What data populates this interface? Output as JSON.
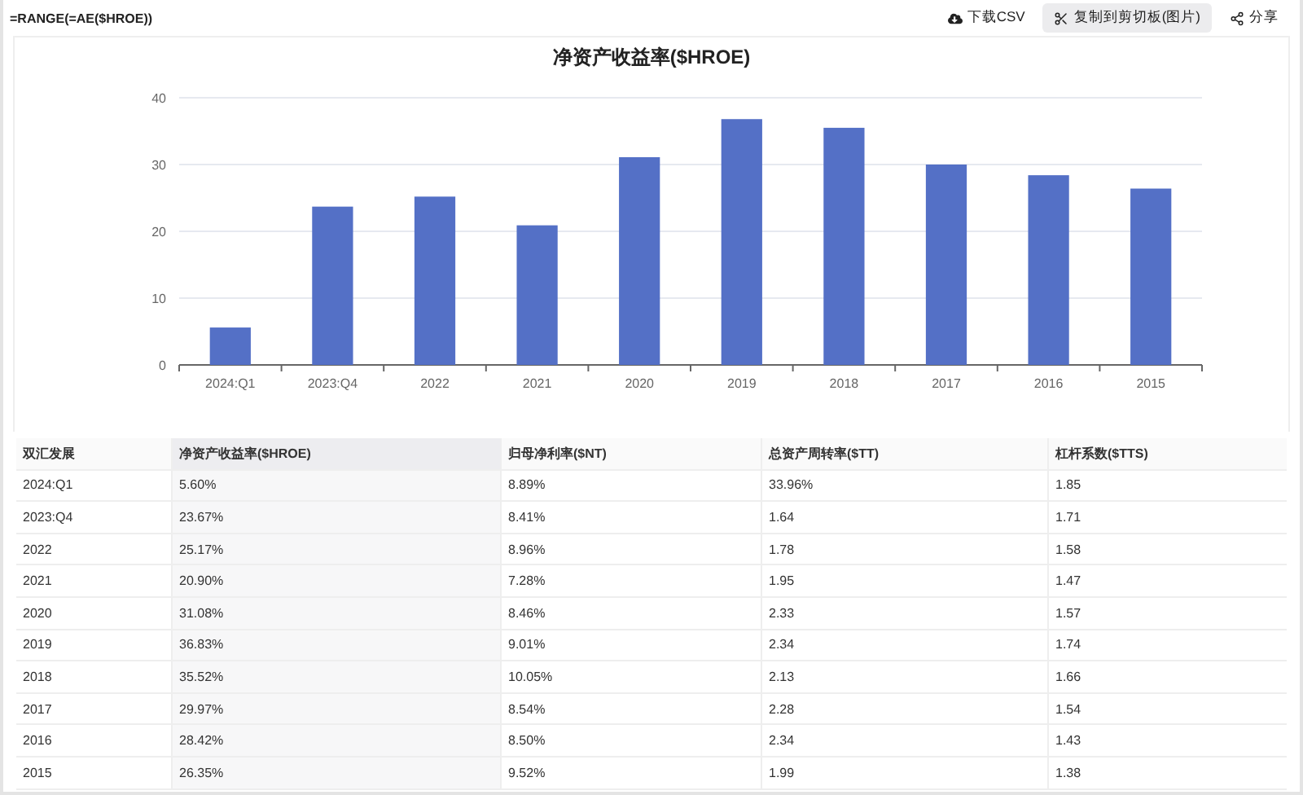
{
  "formula": "=RANGE(=AE($HROE))",
  "actions": [
    {
      "kind": "download",
      "label": "下载CSV",
      "selected": false
    },
    {
      "kind": "copy",
      "label": "复制到剪切板(图片)",
      "selected": true
    },
    {
      "kind": "share",
      "label": "分享",
      "selected": false
    }
  ],
  "chart_data": {
    "type": "bar",
    "title": "净资产收益率($HROE)",
    "categories": [
      "2024:Q1",
      "2023:Q4",
      "2022",
      "2021",
      "2020",
      "2019",
      "2018",
      "2017",
      "2016",
      "2015"
    ],
    "values": [
      5.6,
      23.7,
      25.2,
      20.9,
      31.1,
      36.8,
      35.5,
      30.0,
      28.4,
      26.4
    ],
    "ylim": [
      0,
      40
    ],
    "yticks": [
      0,
      10,
      20,
      30,
      40
    ],
    "grid": true
  },
  "table": {
    "columns": [
      {
        "label": "双汇发展",
        "highlighted": false
      },
      {
        "label": "净资产收益率($HROE)",
        "highlighted": true
      },
      {
        "label": "归母净利率($NT)",
        "highlighted": false
      },
      {
        "label": "总资产周转率($TT)",
        "highlighted": false
      },
      {
        "label": "杠杆系数($TTS)",
        "highlighted": false
      }
    ],
    "rows": [
      [
        "2024:Q1",
        "5.60%",
        "8.89%",
        "33.96%",
        "1.85"
      ],
      [
        "2023:Q4",
        "23.67%",
        "8.41%",
        "1.64",
        "1.71"
      ],
      [
        "2022",
        "25.17%",
        "8.96%",
        "1.78",
        "1.58"
      ],
      [
        "2021",
        "20.90%",
        "7.28%",
        "1.95",
        "1.47"
      ],
      [
        "2020",
        "31.08%",
        "8.46%",
        "2.33",
        "1.57"
      ],
      [
        "2019",
        "36.83%",
        "9.01%",
        "2.34",
        "1.74"
      ],
      [
        "2018",
        "35.52%",
        "10.05%",
        "2.13",
        "1.66"
      ],
      [
        "2017",
        "29.97%",
        "8.54%",
        "2.28",
        "1.54"
      ],
      [
        "2016",
        "28.42%",
        "8.50%",
        "2.34",
        "1.43"
      ],
      [
        "2015",
        "26.35%",
        "9.52%",
        "1.99",
        "1.38"
      ]
    ]
  }
}
